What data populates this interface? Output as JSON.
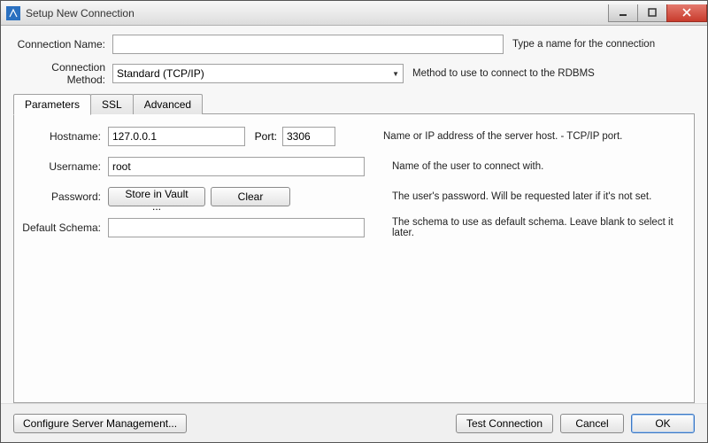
{
  "window": {
    "title": "Setup New Connection"
  },
  "form": {
    "connection_name": {
      "label": "Connection Name:",
      "value": "",
      "hint": "Type a name for the connection"
    },
    "connection_method": {
      "label": "Connection Method:",
      "value": "Standard (TCP/IP)",
      "hint": "Method to use to connect to the RDBMS"
    }
  },
  "tabs": {
    "parameters": "Parameters",
    "ssl": "SSL",
    "advanced": "Advanced"
  },
  "params": {
    "hostname": {
      "label": "Hostname:",
      "value": "127.0.0.1"
    },
    "port": {
      "label": "Port:",
      "value": "3306"
    },
    "host_hint": "Name or IP address of the server host. - TCP/IP port.",
    "username": {
      "label": "Username:",
      "value": "root",
      "hint": "Name of the user to connect with."
    },
    "password": {
      "label": "Password:",
      "store_btn": "Store in Vault ...",
      "clear_btn": "Clear",
      "hint": "The user's password. Will be requested later if it's not set."
    },
    "schema": {
      "label": "Default Schema:",
      "value": "",
      "hint": "The schema to use as default schema. Leave blank to select it later."
    }
  },
  "footer": {
    "configure": "Configure Server Management...",
    "test": "Test Connection",
    "cancel": "Cancel",
    "ok": "OK"
  }
}
